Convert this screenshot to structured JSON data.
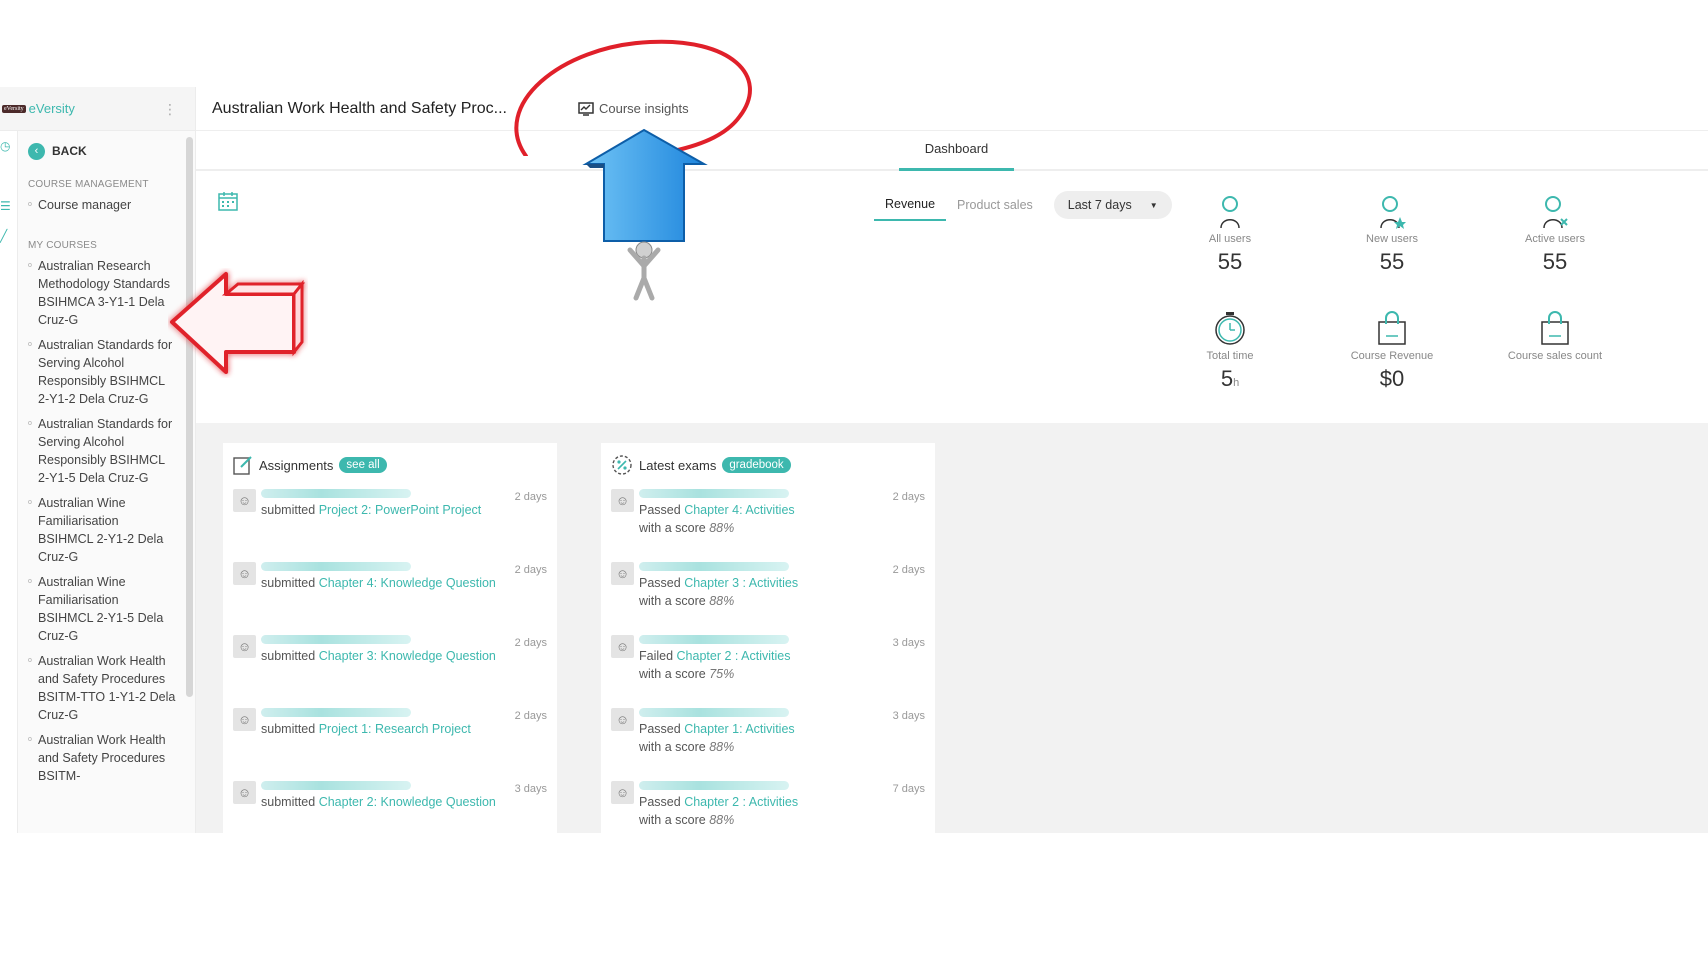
{
  "sidebar": {
    "brand_logo_text": "eVersity",
    "brand_name": "eVersity",
    "back_label": "BACK",
    "course_management_label": "COURSE MANAGEMENT",
    "course_manager_label": "Course manager",
    "my_courses_label": "MY COURSES",
    "courses": [
      "Australian Research Methodology Standards BSIHMCA 3-Y1-1 Dela Cruz-G",
      "Australian Standards for Serving Alcohol Responsibly BSIHMCL 2-Y1-2 Dela Cruz-G",
      "Australian Standards for Serving Alcohol Responsibly BSIHMCL 2-Y1-5 Dela Cruz-G",
      "Australian Wine Familiarisation BSIHMCL 2-Y1-2 Dela Cruz-G",
      "Australian Wine Familiarisation BSIHMCL 2-Y1-5 Dela Cruz-G",
      "Australian Work Health and Safety Procedures BSITM-TTO 1-Y1-2 Dela Cruz-G",
      "Australian Work Health and Safety Procedures BSITM-"
    ]
  },
  "header": {
    "course_title": "Australian Work Health and Safety Proc...",
    "insights_label": "Course insights"
  },
  "tabs": {
    "dashboard": "Dashboard"
  },
  "revenue_tabs": {
    "revenue": "Revenue",
    "product_sales": "Product sales",
    "range": "Last 7 days"
  },
  "stats": {
    "all_users": {
      "label": "All users",
      "value": "55"
    },
    "new_users": {
      "label": "New users",
      "value": "55"
    },
    "active_users": {
      "label": "Active users",
      "value": "55"
    },
    "total_time": {
      "label": "Total time",
      "value": "5",
      "unit": "h"
    },
    "course_revenue": {
      "label": "Course Revenue",
      "value": "$0"
    },
    "course_sales": {
      "label": "Course sales count",
      "value": ""
    }
  },
  "assignments": {
    "title": "Assignments",
    "pill": "see all",
    "items": [
      {
        "verb": "submitted",
        "link": "Project 2: PowerPoint Project",
        "when": "2 days"
      },
      {
        "verb": "submitted",
        "link": "Chapter 4: Knowledge Question",
        "when": "2 days"
      },
      {
        "verb": "submitted",
        "link": "Chapter 3: Knowledge Question",
        "when": "2 days"
      },
      {
        "verb": "submitted",
        "link": "Project 1: Research Project",
        "when": "2 days"
      },
      {
        "verb": "submitted",
        "link": "Chapter 2: Knowledge Question",
        "when": "3 days"
      }
    ]
  },
  "exams": {
    "title": "Latest exams",
    "pill": "gradebook",
    "score_prefix": "with a score",
    "items": [
      {
        "verb": "Passed",
        "link": "Chapter 4: Activities",
        "score": "88%",
        "when": "2 days"
      },
      {
        "verb": "Passed",
        "link": "Chapter 3 : Activities",
        "score": "88%",
        "when": "2 days"
      },
      {
        "verb": "Failed",
        "link": "Chapter 2 : Activities",
        "score": "75%",
        "when": "3 days"
      },
      {
        "verb": "Passed",
        "link": "Chapter 1: Activities",
        "score": "88%",
        "when": "3 days"
      },
      {
        "verb": "Passed",
        "link": "Chapter 2 : Activities",
        "score": "88%",
        "when": "7 days"
      }
    ]
  },
  "colors": {
    "accent": "#3db8ae",
    "annotation_red": "#e0202a",
    "arrow_blue": "#2b9be8"
  }
}
